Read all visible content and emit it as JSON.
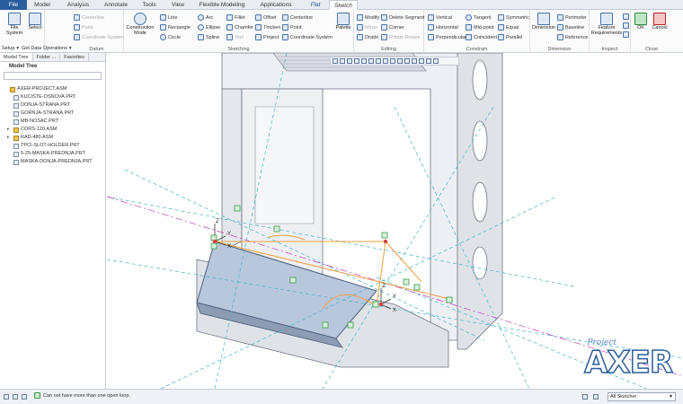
{
  "menu": {
    "tabs": [
      "File",
      "Model",
      "Analysis",
      "Annotate",
      "Tools",
      "View",
      "Flexible Modeling",
      "Applications",
      "Flat",
      "Sketch"
    ]
  },
  "ribbon": {
    "setup": {
      "file_system": "File System",
      "select": "Select"
    },
    "datum": {
      "centerline": "Centerline",
      "point": "Point",
      "coordinate_system": "Coordinate System",
      "label": "Datum"
    },
    "sketching": {
      "construction_mode": "Construction Mode",
      "line": "Line",
      "rectangle": "Rectangle",
      "circle": "Circle",
      "arc": "Arc",
      "ellipse": "Ellipse",
      "spline": "Spline",
      "fillet": "Fillet",
      "chamfer": "Chamfer",
      "text": "Text",
      "offset": "Offset",
      "thicken": "Thicken",
      "project": "Project",
      "centerline": "Centerline",
      "point": "Point",
      "coordinate_system": "Coordinate System",
      "palette": "Palette",
      "label": "Sketching"
    },
    "editing": {
      "modify": "Modify",
      "mirror": "Mirror",
      "divide": "Divide",
      "delete_segment": "Delete Segment",
      "corner": "Corner",
      "rotate_resize": "Rotate Resize",
      "label": "Editing"
    },
    "constrain": {
      "vertical": "Vertical",
      "horizontal": "Horizontal",
      "perpendicular": "Perpendicular",
      "tangent": "Tangent",
      "mid_point": "Mid-point",
      "coincident": "Coincident",
      "symmetric": "Symmetric",
      "equal": "Equal",
      "parallel": "Parallel",
      "label": "Constrain"
    },
    "dimension": {
      "dimension": "Dimension",
      "perimeter": "Perimeter",
      "baseline": "Baseline",
      "reference": "Reference",
      "label": "Dimension"
    },
    "inspect": {
      "feature_requirements": "Feature Requirements",
      "label": "Inspect"
    },
    "close": {
      "ok": "OK",
      "cancel": "Cancel",
      "label": "Close"
    }
  },
  "subbar": {
    "setup": "Setup",
    "get_data": "Get Data",
    "operations": "Operations"
  },
  "left_panel": {
    "tabs": [
      "Model Tree",
      "Folder ...",
      "Favorites"
    ],
    "tree_title": "Model Tree",
    "items": [
      {
        "name": "AXER-PROJECT.ASM",
        "type": "asm",
        "expandable": false
      },
      {
        "name": "KUCISTE-OSNOVA.PRT",
        "type": "prt",
        "expandable": false
      },
      {
        "name": "DONJA-STRANA.PRT",
        "type": "prt",
        "expandable": false
      },
      {
        "name": "GORNJA-STRANA.PRT",
        "type": "prt",
        "expandable": false
      },
      {
        "name": "MB-NOSAC.PRT",
        "type": "prt",
        "expandable": false
      },
      {
        "name": "CORS-120.ASM",
        "type": "asm",
        "expandable": true
      },
      {
        "name": "RAD-480.ASM",
        "type": "asm",
        "expandable": true
      },
      {
        "name": "TPCI-SLOT-HOLDER.PRT",
        "type": "prt",
        "expandable": false
      },
      {
        "name": "5-25-MASKA-PREDNJA.PRT",
        "type": "prt",
        "expandable": false
      },
      {
        "name": "MASKA-DONJA-PREDNJA.PRT",
        "type": "prt",
        "expandable": false
      }
    ]
  },
  "graphics": {
    "axis_labels": [
      "Z",
      "Y",
      "X",
      "Z",
      "Y",
      "X"
    ]
  },
  "logo": {
    "tag": "Project",
    "main": "AXER"
  },
  "status": {
    "message": "Can not have more than one open loop.",
    "filter": "All Sketcher"
  },
  "colors": {
    "file_tab": "#2a5d9e",
    "sketch_orange": "#f0a040",
    "construction_cyan": "#3fb5c8",
    "datum_magenta": "#c23cc2",
    "constraint_green": "#3a9a48",
    "logo_blue": "#2d5d9a"
  }
}
